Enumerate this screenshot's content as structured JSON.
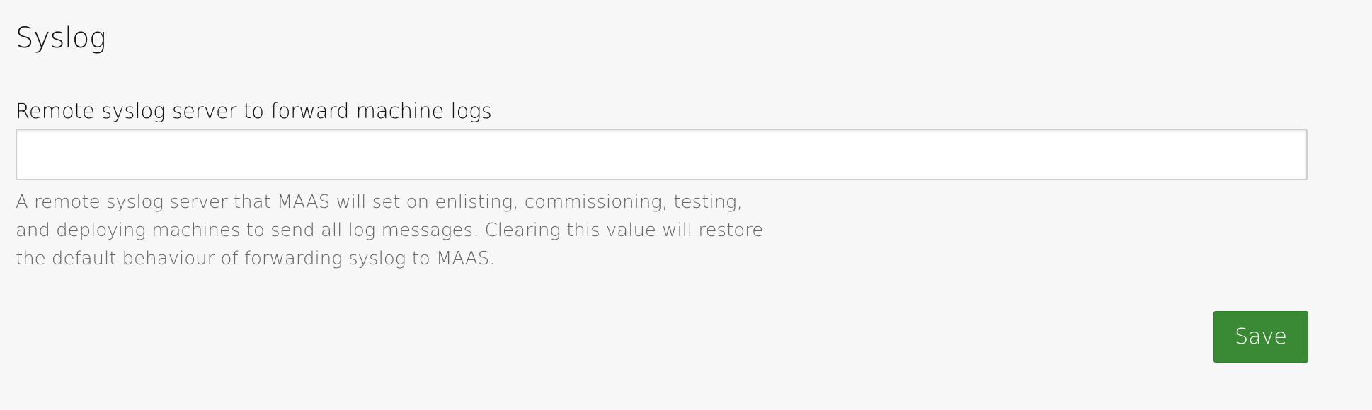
{
  "section": {
    "title": "Syslog"
  },
  "form": {
    "remote_syslog": {
      "label": "Remote syslog server to forward machine logs",
      "value": "",
      "placeholder": "",
      "help_text": "A remote syslog server that MAAS will set on enlisting, commissioning, testing, and deploying machines to send all log messages. Clearing this value will restore the default behaviour of forwarding syslog to MAAS."
    },
    "save_label": "Save"
  },
  "colors": {
    "background": "#f7f7f7",
    "button_positive": "#3a8a35",
    "help_text": "#666666"
  }
}
